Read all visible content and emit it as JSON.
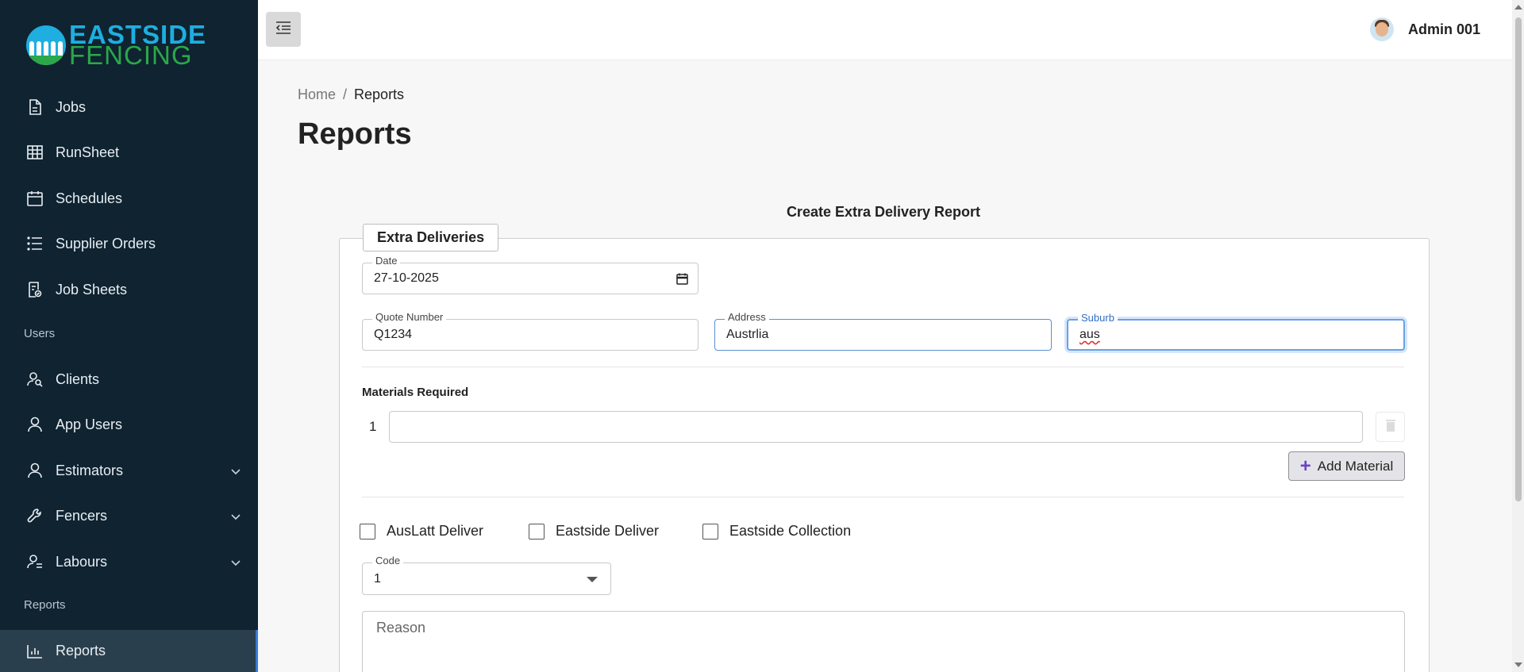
{
  "brand": {
    "line1": "EASTSIDE",
    "line2": "FENCING"
  },
  "sidebar": {
    "items": [
      {
        "label": "Jobs",
        "icon": "document-icon"
      },
      {
        "label": "RunSheet",
        "icon": "grid-icon"
      },
      {
        "label": "Schedules",
        "icon": "calendar-icon"
      },
      {
        "label": "Supplier Orders",
        "icon": "list-icon"
      },
      {
        "label": "Job Sheets",
        "icon": "job-sheet-icon"
      }
    ],
    "section_users": "Users",
    "user_items": [
      {
        "label": "Clients",
        "icon": "clients-icon"
      },
      {
        "label": "App Users",
        "icon": "user-icon"
      },
      {
        "label": "Estimators",
        "icon": "user-icon"
      },
      {
        "label": "Fencers",
        "icon": "wrench-icon"
      },
      {
        "label": "Labours",
        "icon": "labour-icon"
      }
    ],
    "section_reports": "Reports",
    "reports_item": {
      "label": "Reports",
      "icon": "bar-chart-icon"
    }
  },
  "topbar": {
    "user_name": "Admin 001"
  },
  "breadcrumb": {
    "home": "Home",
    "separator": "/",
    "current": "Reports"
  },
  "page_title": "Reports",
  "form": {
    "title": "Create Extra Delivery Report",
    "legend": "Extra Deliveries",
    "date": {
      "label": "Date",
      "value": "27-10-2025"
    },
    "quote_number": {
      "label": "Quote Number",
      "value": "Q1234"
    },
    "address": {
      "label": "Address",
      "value": "Austrlia"
    },
    "suburb": {
      "label": "Suburb",
      "value": "aus"
    },
    "materials": {
      "label": "Materials Required",
      "rows": [
        {
          "number": "1",
          "value": ""
        }
      ],
      "add_label": "Add Material"
    },
    "checkboxes": [
      {
        "label": "AusLatt Deliver",
        "checked": false
      },
      {
        "label": "Eastside Deliver",
        "checked": false
      },
      {
        "label": "Eastside Collection",
        "checked": false
      }
    ],
    "code": {
      "label": "Code",
      "value": "1"
    },
    "reason": {
      "placeholder": "Reason"
    }
  },
  "colors": {
    "sidebar_bg": "#0f2331",
    "brand_blue": "#1eaee0",
    "brand_green": "#2aa84a",
    "focus_blue": "#5b8fd6"
  }
}
